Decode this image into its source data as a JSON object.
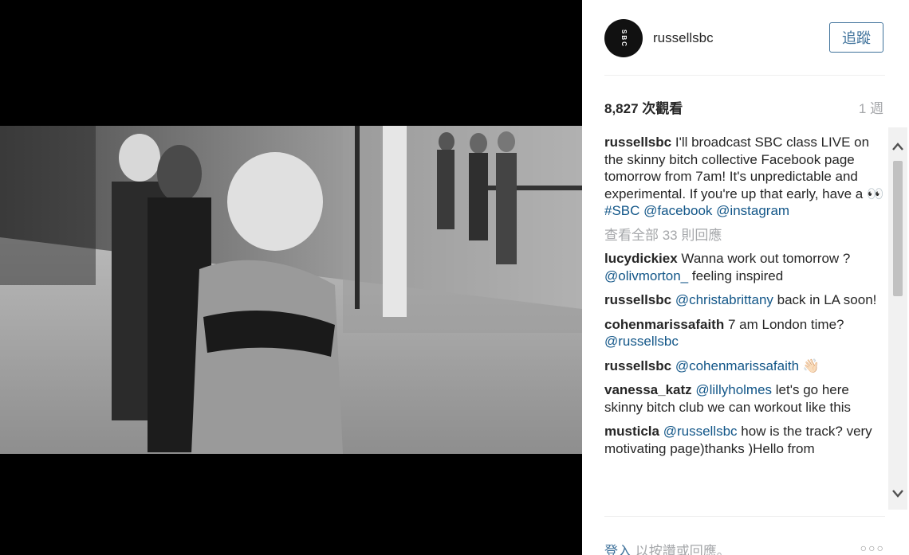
{
  "post": {
    "username": "russellsbc",
    "avatar_text": "SBC",
    "follow_label": "追蹤",
    "views": "8,827 次觀看",
    "age": "1 週"
  },
  "caption": {
    "author": "russellsbc",
    "text": "I'll broadcast SBC class LIVE on the skinny bitch collective Facebook page tomorrow from 7am! It's unpredictable and experimental. If you're up that early, have a 👀 ",
    "tags": [
      "#SBC",
      "@facebook",
      "@instagram"
    ]
  },
  "load_more": "查看全部 33 則回應",
  "comments": [
    {
      "author": "lucydickiex",
      "text_before": "Wanna work out tomorrow ? ",
      "mention": "@olivmorton_",
      "text_after": " feeling inspired"
    },
    {
      "author": "russellsbc",
      "text_before": "",
      "mention": "@christabrittany",
      "text_after": " back in LA soon!"
    },
    {
      "author": "cohenmarissafaith",
      "text_before": "7 am London time? ",
      "mention": "@russellsbc",
      "text_after": ""
    },
    {
      "author": "russellsbc",
      "text_before": "",
      "mention": "@cohenmarissafaith",
      "text_after": " 👋🏻"
    },
    {
      "author": "vanessa_katz",
      "text_before": "",
      "mention": "@lillyholmes",
      "text_after": " let's go here skinny bitch club we can workout like this"
    },
    {
      "author": "musticla",
      "text_before": "",
      "mention": "@russellsbc",
      "text_after": " how is the track? very motivating page)thanks )Hello from"
    }
  ],
  "footer": {
    "login": "登入",
    "rest": " 以按讚或回應。",
    "more": "○○○"
  },
  "icons": {
    "scroll_up": "chevron-up-icon",
    "scroll_down": "chevron-down-icon",
    "more": "more-options-icon"
  }
}
